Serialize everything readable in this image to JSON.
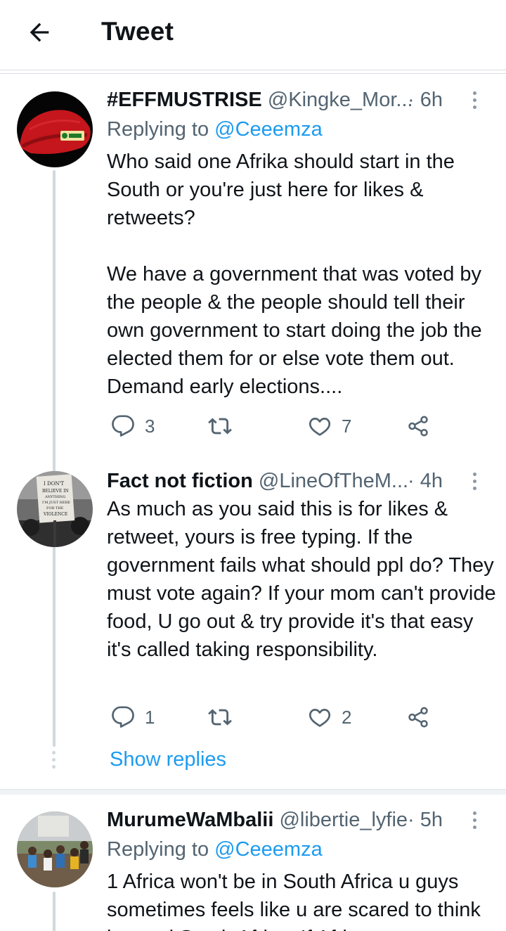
{
  "header": {
    "title": "Tweet",
    "back_icon": "arrow-left-icon"
  },
  "tweets": [
    {
      "name": "#EFFMUSTRISE",
      "handle": "@Kingke_Mor...",
      "time": "· 6h",
      "replying_prefix": "Replying to ",
      "replying_to": "@Ceeemza",
      "text": "Who said one Afrika should start in the South or you're just here for likes & retweets?\n\nWe have a government that was voted by the people & the people should tell their own government to start doing the job the elected them for or else vote them out. Demand early elections....",
      "replies": "3",
      "retweets": "",
      "likes": "7"
    },
    {
      "name": "Fact not fiction",
      "handle": "@LineOfTheM...",
      "time": "· 4h",
      "text": "As much as you said this is for likes & retweet, yours is free typing. If the government fails what should ppl do? They must vote again? If your mom can't provide food, U go out & try provide it's that easy it's called taking responsibility.",
      "replies": "1",
      "retweets": "",
      "likes": "2",
      "sign_text": "I DON'T BELIEVE IN ANYTHING I'M JUST HERE FOR THE VIOLENCE"
    },
    {
      "name": "MurumeWaMbalii",
      "handle": "@libertie_lyfie",
      "time": "· 5h",
      "replying_prefix": "Replying to ",
      "replying_to": "@Ceeemza",
      "text": "1 Africa won't be in South Africa u guys sometimes feels like u are scared to think beyond South Africa. If Africa"
    }
  ],
  "show_replies": "Show replies",
  "colors": {
    "accent": "#1d9bf0",
    "secondary_text": "#536471",
    "thread_line": "#cfd9de"
  }
}
